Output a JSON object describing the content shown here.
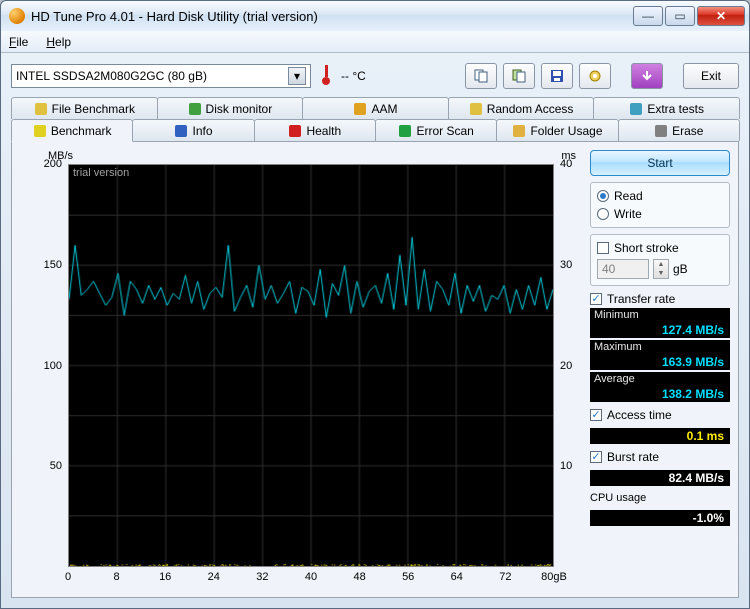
{
  "window": {
    "title": "HD Tune Pro 4.01 - Hard Disk Utility (trial version)"
  },
  "menu": {
    "file": "File",
    "help": "Help"
  },
  "toolbar": {
    "drive": "INTEL SSDSA2M080G2GC (80 gB)",
    "temp": "-- °C",
    "exit": "Exit"
  },
  "tabs_row1": [
    {
      "icon": "file-benchmark-icon",
      "label": "File Benchmark"
    },
    {
      "icon": "disk-monitor-icon",
      "label": "Disk monitor"
    },
    {
      "icon": "aam-icon",
      "label": "AAM"
    },
    {
      "icon": "random-access-icon",
      "label": "Random Access"
    },
    {
      "icon": "extra-tests-icon",
      "label": "Extra tests"
    }
  ],
  "tabs_row2": [
    {
      "icon": "benchmark-icon",
      "label": "Benchmark",
      "active": true
    },
    {
      "icon": "info-icon",
      "label": "Info"
    },
    {
      "icon": "health-icon",
      "label": "Health"
    },
    {
      "icon": "error-scan-icon",
      "label": "Error Scan"
    },
    {
      "icon": "folder-usage-icon",
      "label": "Folder Usage"
    },
    {
      "icon": "erase-icon",
      "label": "Erase"
    }
  ],
  "chart": {
    "watermark": "trial version",
    "yleft_label": "MB/s",
    "yright_label": "ms",
    "xunit": "gB"
  },
  "chart_data": {
    "type": "line",
    "xlabel": "gB",
    "xlim": [
      0,
      80
    ],
    "xticks": [
      0,
      8,
      16,
      24,
      32,
      40,
      48,
      56,
      64,
      72,
      80
    ],
    "series": [
      {
        "name": "Transfer rate (MB/s)",
        "axis": "left",
        "ylabel": "MB/s",
        "ylim": [
          0,
          200
        ],
        "yticks": [
          50,
          100,
          150,
          200
        ],
        "color": "#00d0e0",
        "x_step": 1,
        "values": [
          133,
          160,
          135,
          138,
          142,
          136,
          130,
          134,
          146,
          125,
          142,
          138,
          131,
          140,
          133,
          139,
          130,
          136,
          133,
          145,
          131,
          142,
          128,
          136,
          139,
          134,
          160,
          127,
          134,
          140,
          129,
          150,
          133,
          140,
          131,
          136,
          142,
          126,
          139,
          137,
          130,
          148,
          124,
          141,
          135,
          150,
          126,
          142,
          129,
          137,
          140,
          131,
          146,
          128,
          155,
          130,
          164,
          128,
          148,
          127,
          142,
          138,
          130,
          146,
          126,
          140,
          132,
          140,
          127,
          135,
          133,
          140,
          126,
          138,
          128,
          140,
          130,
          144,
          128,
          138
        ]
      },
      {
        "name": "Access time (ms)",
        "axis": "right",
        "ylabel": "ms",
        "ylim": [
          0,
          40
        ],
        "yticks": [
          10,
          20,
          30,
          40
        ],
        "color": "#ffee00",
        "style": "dots",
        "constant": 0.1
      }
    ]
  },
  "side": {
    "start": "Start",
    "read": "Read",
    "write": "Write",
    "short_stroke": "Short stroke",
    "short_stroke_val": "40",
    "short_stroke_unit": "gB",
    "transfer_rate": "Transfer rate",
    "minimum": "Minimum",
    "minimum_val": "127.4 MB/s",
    "maximum": "Maximum",
    "maximum_val": "163.9 MB/s",
    "average": "Average",
    "average_val": "138.2 MB/s",
    "access_time": "Access time",
    "access_time_val": "0.1 ms",
    "burst_rate": "Burst rate",
    "burst_rate_val": "82.4 MB/s",
    "cpu_usage": "CPU usage",
    "cpu_usage_val": "-1.0%"
  }
}
